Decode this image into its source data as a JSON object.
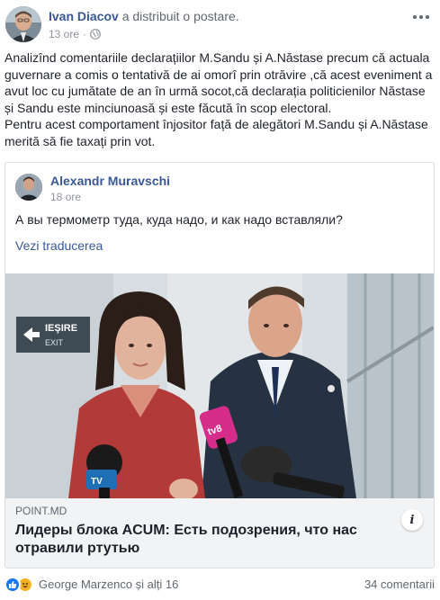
{
  "post": {
    "author": "Ivan Diacov",
    "action": "a distribuit o postare.",
    "time": "13 ore",
    "separator": "·",
    "text_lines": [
      "Analizînd comentariile declarațiilor M.Sandu și A.Năstase precum că actuala guvernare a comis o tentativă de ai omorî prin otrăvire ,că acest eveniment a avut loc cu jumătate de an în urmă socot,că declarația politicienilor Năstase și Sandu este minciunoasă și este făcută în scop electoral.",
      "Pentru acest comportament înjositor față de alegători M.Sandu și A.Năstase merită să fie taxați prin vot."
    ]
  },
  "shared": {
    "author": "Alexandr Muravschi",
    "time": "18 ore",
    "text": "А вы термометр туда, куда надо, и как надо вставляли?",
    "translate_label": "Vezi traducerea",
    "photo": {
      "sign_text": "IEŞIRE",
      "sign_subtext": "EXIT",
      "mic_label": "tv8",
      "mic_label2": "TV"
    },
    "link": {
      "source": "POINT.MD",
      "title": "Лидеры блока ACUM: Есть подозрения, что нас отравили ртутью",
      "info_icon": "i"
    }
  },
  "footer": {
    "reaction_icons": [
      "like-icon",
      "haha-icon"
    ],
    "reactors": "George Marzenco și alți 16",
    "comments": "34 comentarii"
  },
  "colors": {
    "link_blue": "#385898",
    "text": "#1d2129",
    "meta_gray": "#90949c",
    "caption_bg": "#f2f3f5"
  }
}
